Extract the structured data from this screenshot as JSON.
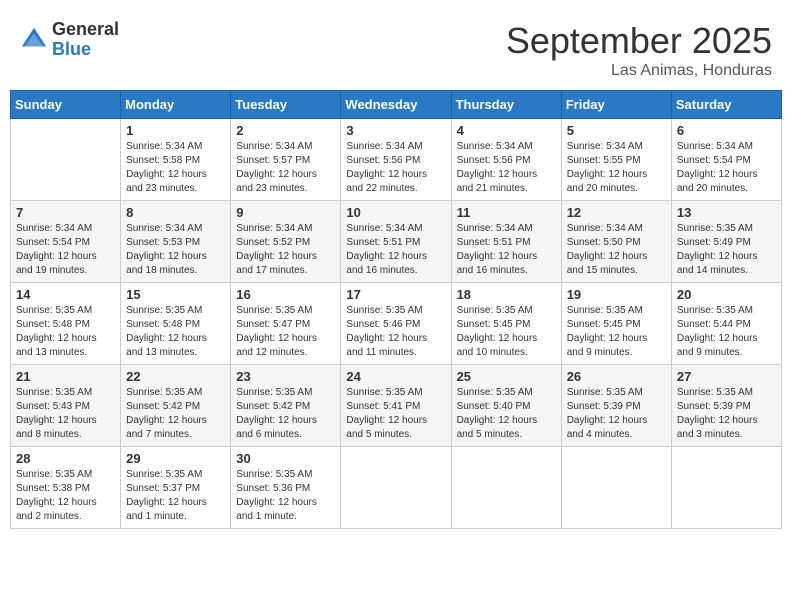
{
  "header": {
    "logo_general": "General",
    "logo_blue": "Blue",
    "month_title": "September 2025",
    "location": "Las Animas, Honduras"
  },
  "weekdays": [
    "Sunday",
    "Monday",
    "Tuesday",
    "Wednesday",
    "Thursday",
    "Friday",
    "Saturday"
  ],
  "weeks": [
    [
      {
        "day": "",
        "sunrise": "",
        "sunset": "",
        "daylight": ""
      },
      {
        "day": "1",
        "sunrise": "Sunrise: 5:34 AM",
        "sunset": "Sunset: 5:58 PM",
        "daylight": "Daylight: 12 hours and 23 minutes."
      },
      {
        "day": "2",
        "sunrise": "Sunrise: 5:34 AM",
        "sunset": "Sunset: 5:57 PM",
        "daylight": "Daylight: 12 hours and 23 minutes."
      },
      {
        "day": "3",
        "sunrise": "Sunrise: 5:34 AM",
        "sunset": "Sunset: 5:56 PM",
        "daylight": "Daylight: 12 hours and 22 minutes."
      },
      {
        "day": "4",
        "sunrise": "Sunrise: 5:34 AM",
        "sunset": "Sunset: 5:56 PM",
        "daylight": "Daylight: 12 hours and 21 minutes."
      },
      {
        "day": "5",
        "sunrise": "Sunrise: 5:34 AM",
        "sunset": "Sunset: 5:55 PM",
        "daylight": "Daylight: 12 hours and 20 minutes."
      },
      {
        "day": "6",
        "sunrise": "Sunrise: 5:34 AM",
        "sunset": "Sunset: 5:54 PM",
        "daylight": "Daylight: 12 hours and 20 minutes."
      }
    ],
    [
      {
        "day": "7",
        "sunrise": "Sunrise: 5:34 AM",
        "sunset": "Sunset: 5:54 PM",
        "daylight": "Daylight: 12 hours and 19 minutes."
      },
      {
        "day": "8",
        "sunrise": "Sunrise: 5:34 AM",
        "sunset": "Sunset: 5:53 PM",
        "daylight": "Daylight: 12 hours and 18 minutes."
      },
      {
        "day": "9",
        "sunrise": "Sunrise: 5:34 AM",
        "sunset": "Sunset: 5:52 PM",
        "daylight": "Daylight: 12 hours and 17 minutes."
      },
      {
        "day": "10",
        "sunrise": "Sunrise: 5:34 AM",
        "sunset": "Sunset: 5:51 PM",
        "daylight": "Daylight: 12 hours and 16 minutes."
      },
      {
        "day": "11",
        "sunrise": "Sunrise: 5:34 AM",
        "sunset": "Sunset: 5:51 PM",
        "daylight": "Daylight: 12 hours and 16 minutes."
      },
      {
        "day": "12",
        "sunrise": "Sunrise: 5:34 AM",
        "sunset": "Sunset: 5:50 PM",
        "daylight": "Daylight: 12 hours and 15 minutes."
      },
      {
        "day": "13",
        "sunrise": "Sunrise: 5:35 AM",
        "sunset": "Sunset: 5:49 PM",
        "daylight": "Daylight: 12 hours and 14 minutes."
      }
    ],
    [
      {
        "day": "14",
        "sunrise": "Sunrise: 5:35 AM",
        "sunset": "Sunset: 5:48 PM",
        "daylight": "Daylight: 12 hours and 13 minutes."
      },
      {
        "day": "15",
        "sunrise": "Sunrise: 5:35 AM",
        "sunset": "Sunset: 5:48 PM",
        "daylight": "Daylight: 12 hours and 13 minutes."
      },
      {
        "day": "16",
        "sunrise": "Sunrise: 5:35 AM",
        "sunset": "Sunset: 5:47 PM",
        "daylight": "Daylight: 12 hours and 12 minutes."
      },
      {
        "day": "17",
        "sunrise": "Sunrise: 5:35 AM",
        "sunset": "Sunset: 5:46 PM",
        "daylight": "Daylight: 12 hours and 11 minutes."
      },
      {
        "day": "18",
        "sunrise": "Sunrise: 5:35 AM",
        "sunset": "Sunset: 5:45 PM",
        "daylight": "Daylight: 12 hours and 10 minutes."
      },
      {
        "day": "19",
        "sunrise": "Sunrise: 5:35 AM",
        "sunset": "Sunset: 5:45 PM",
        "daylight": "Daylight: 12 hours and 9 minutes."
      },
      {
        "day": "20",
        "sunrise": "Sunrise: 5:35 AM",
        "sunset": "Sunset: 5:44 PM",
        "daylight": "Daylight: 12 hours and 9 minutes."
      }
    ],
    [
      {
        "day": "21",
        "sunrise": "Sunrise: 5:35 AM",
        "sunset": "Sunset: 5:43 PM",
        "daylight": "Daylight: 12 hours and 8 minutes."
      },
      {
        "day": "22",
        "sunrise": "Sunrise: 5:35 AM",
        "sunset": "Sunset: 5:42 PM",
        "daylight": "Daylight: 12 hours and 7 minutes."
      },
      {
        "day": "23",
        "sunrise": "Sunrise: 5:35 AM",
        "sunset": "Sunset: 5:42 PM",
        "daylight": "Daylight: 12 hours and 6 minutes."
      },
      {
        "day": "24",
        "sunrise": "Sunrise: 5:35 AM",
        "sunset": "Sunset: 5:41 PM",
        "daylight": "Daylight: 12 hours and 5 minutes."
      },
      {
        "day": "25",
        "sunrise": "Sunrise: 5:35 AM",
        "sunset": "Sunset: 5:40 PM",
        "daylight": "Daylight: 12 hours and 5 minutes."
      },
      {
        "day": "26",
        "sunrise": "Sunrise: 5:35 AM",
        "sunset": "Sunset: 5:39 PM",
        "daylight": "Daylight: 12 hours and 4 minutes."
      },
      {
        "day": "27",
        "sunrise": "Sunrise: 5:35 AM",
        "sunset": "Sunset: 5:39 PM",
        "daylight": "Daylight: 12 hours and 3 minutes."
      }
    ],
    [
      {
        "day": "28",
        "sunrise": "Sunrise: 5:35 AM",
        "sunset": "Sunset: 5:38 PM",
        "daylight": "Daylight: 12 hours and 2 minutes."
      },
      {
        "day": "29",
        "sunrise": "Sunrise: 5:35 AM",
        "sunset": "Sunset: 5:37 PM",
        "daylight": "Daylight: 12 hours and 1 minute."
      },
      {
        "day": "30",
        "sunrise": "Sunrise: 5:35 AM",
        "sunset": "Sunset: 5:36 PM",
        "daylight": "Daylight: 12 hours and 1 minute."
      },
      {
        "day": "",
        "sunrise": "",
        "sunset": "",
        "daylight": ""
      },
      {
        "day": "",
        "sunrise": "",
        "sunset": "",
        "daylight": ""
      },
      {
        "day": "",
        "sunrise": "",
        "sunset": "",
        "daylight": ""
      },
      {
        "day": "",
        "sunrise": "",
        "sunset": "",
        "daylight": ""
      }
    ]
  ]
}
